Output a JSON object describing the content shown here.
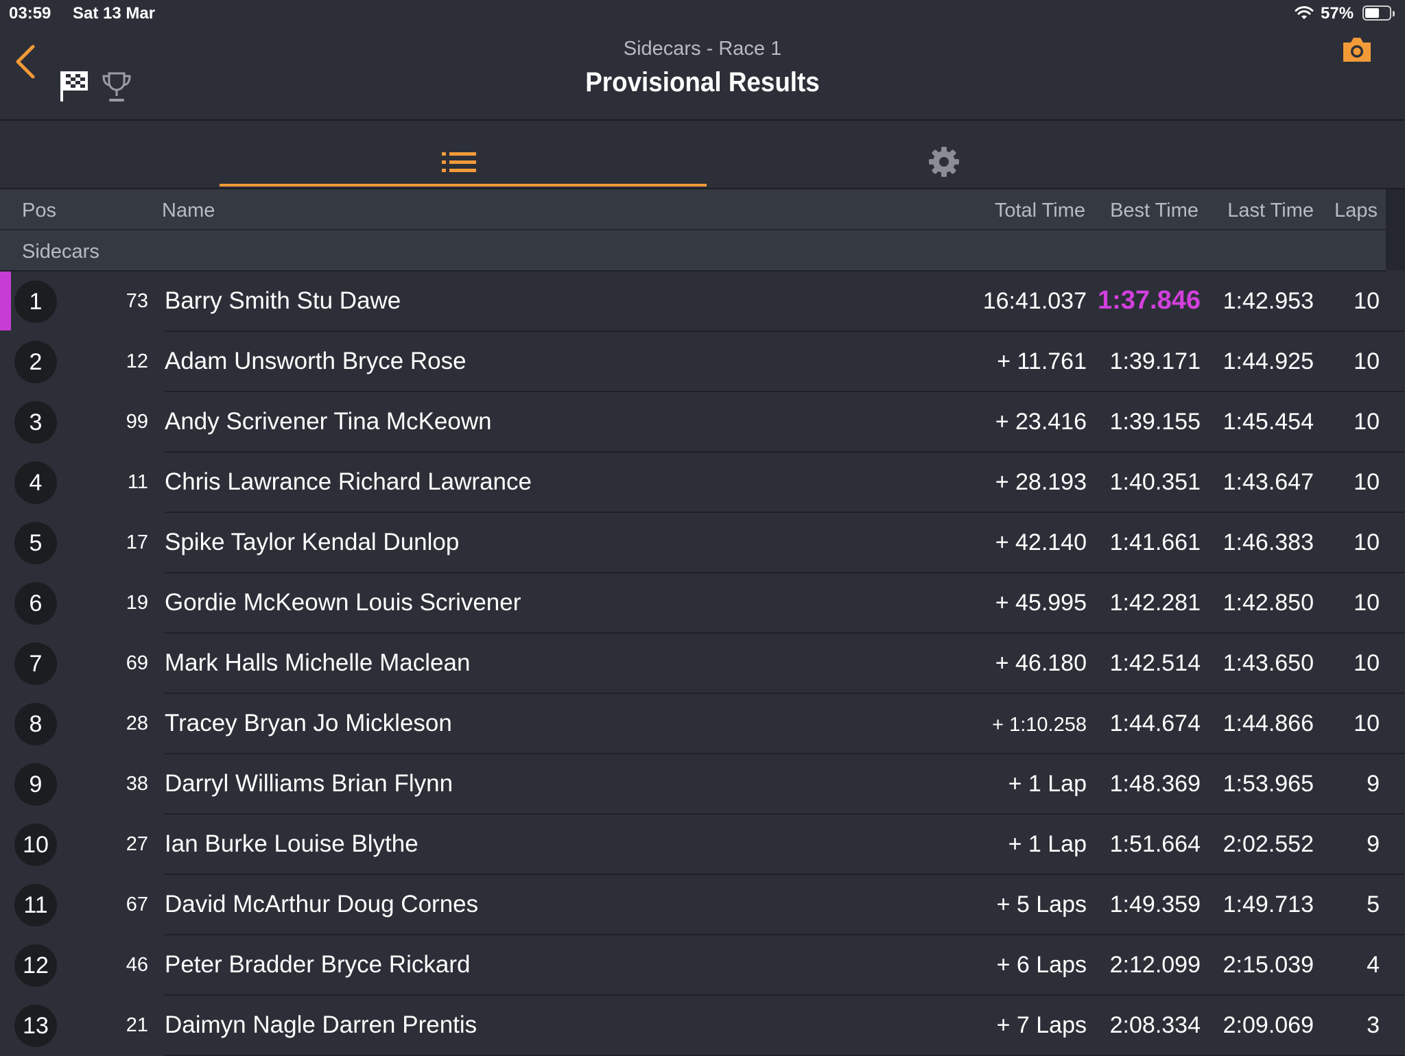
{
  "status_bar": {
    "time": "03:59",
    "date": "Sat 13 Mar",
    "battery": "57%"
  },
  "header": {
    "subtitle": "Sidecars - Race 1",
    "title": "Provisional Results"
  },
  "icons": {
    "back": "chevron-left-icon",
    "flag": "checkered-flag-icon",
    "trophy": "trophy-icon",
    "camera": "camera-icon",
    "list": "list-icon",
    "settings": "gear-icon",
    "wifi": "wifi-icon",
    "battery": "battery-icon"
  },
  "colors": {
    "accent": "#f29a38",
    "fastest_lap": "#d33fdd",
    "background": "#2c2f37"
  },
  "columns": {
    "pos": "Pos",
    "name": "Name",
    "total": "Total Time",
    "best": "Best Time",
    "last": "Last Time",
    "laps": "Laps"
  },
  "group": "Sidecars",
  "rows": [
    {
      "pos": "1",
      "num": "73",
      "name": "Barry Smith Stu Dawe",
      "total": "16:41.037",
      "best": "1:37.846",
      "last": "1:42.953",
      "laps": "10"
    },
    {
      "pos": "2",
      "num": "12",
      "name": "Adam Unsworth Bryce Rose",
      "total": "+ 11.761",
      "best": "1:39.171",
      "last": "1:44.925",
      "laps": "10"
    },
    {
      "pos": "3",
      "num": "99",
      "name": "Andy Scrivener Tina McKeown",
      "total": "+ 23.416",
      "best": "1:39.155",
      "last": "1:45.454",
      "laps": "10"
    },
    {
      "pos": "4",
      "num": "11",
      "name": "Chris Lawrance Richard Lawrance",
      "total": "+ 28.193",
      "best": "1:40.351",
      "last": "1:43.647",
      "laps": "10"
    },
    {
      "pos": "5",
      "num": "17",
      "name": "Spike Taylor Kendal Dunlop",
      "total": "+ 42.140",
      "best": "1:41.661",
      "last": "1:46.383",
      "laps": "10"
    },
    {
      "pos": "6",
      "num": "19",
      "name": "Gordie McKeown Louis Scrivener",
      "total": "+ 45.995",
      "best": "1:42.281",
      "last": "1:42.850",
      "laps": "10"
    },
    {
      "pos": "7",
      "num": "69",
      "name": "Mark Halls Michelle Maclean",
      "total": "+ 46.180",
      "best": "1:42.514",
      "last": "1:43.650",
      "laps": "10"
    },
    {
      "pos": "8",
      "num": "28",
      "name": "Tracey Bryan Jo Mickleson",
      "total": "+ 1:10.258",
      "best": "1:44.674",
      "last": "1:44.866",
      "laps": "10"
    },
    {
      "pos": "9",
      "num": "38",
      "name": "Darryl Williams Brian Flynn",
      "total": "+ 1 Lap",
      "best": "1:48.369",
      "last": "1:53.965",
      "laps": "9"
    },
    {
      "pos": "10",
      "num": "27",
      "name": "Ian Burke Louise Blythe",
      "total": "+ 1 Lap",
      "best": "1:51.664",
      "last": "2:02.552",
      "laps": "9"
    },
    {
      "pos": "11",
      "num": "67",
      "name": "David McArthur Doug Cornes",
      "total": "+ 5 Laps",
      "best": "1:49.359",
      "last": "1:49.713",
      "laps": "5"
    },
    {
      "pos": "12",
      "num": "46",
      "name": "Peter Bradder Bryce Rickard",
      "total": "+ 6 Laps",
      "best": "2:12.099",
      "last": "2:15.039",
      "laps": "4"
    },
    {
      "pos": "13",
      "num": "21",
      "name": "Daimyn Nagle Darren Prentis",
      "total": "+ 7 Laps",
      "best": "2:08.334",
      "last": "2:09.069",
      "laps": "3"
    }
  ]
}
